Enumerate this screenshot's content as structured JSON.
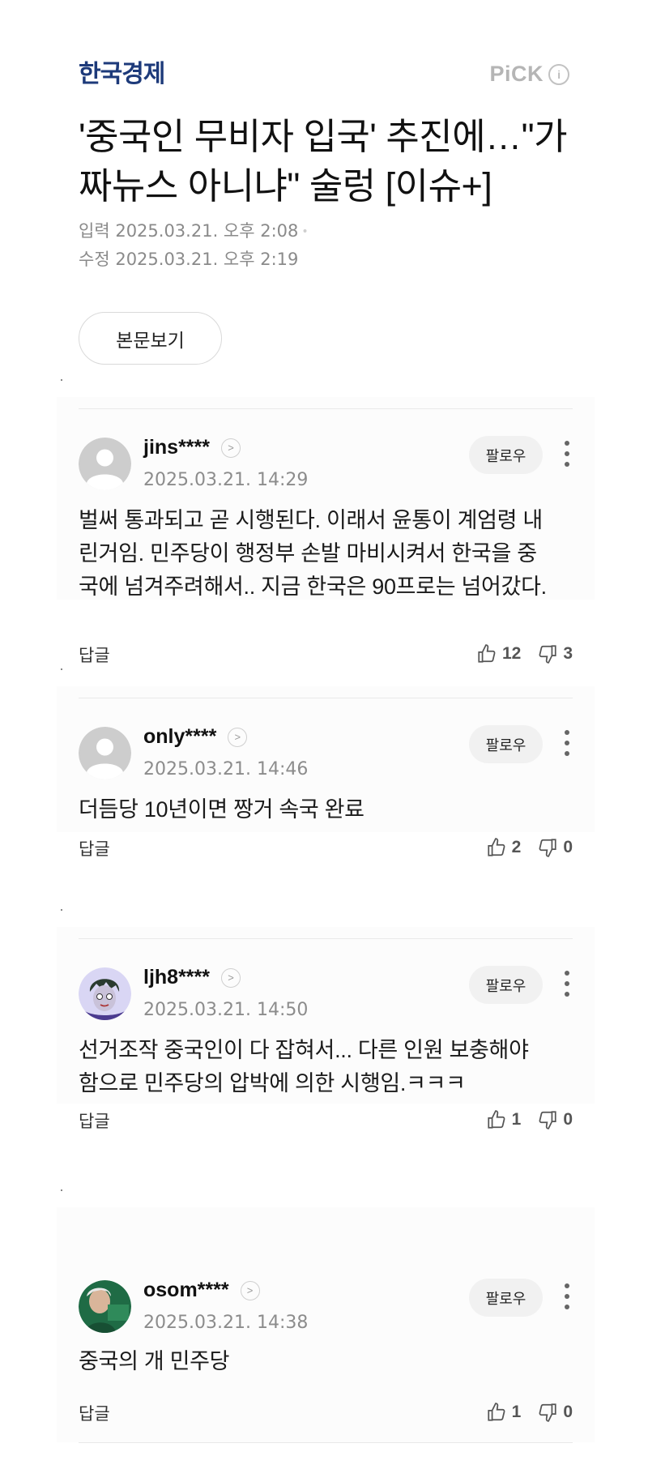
{
  "publisher": "한국경제",
  "pick": {
    "label": "PiCK",
    "info_icon": "i"
  },
  "headline": "'중국인 무비자 입국' 추진에…\"가짜뉴스 아니냐\" 술렁 [이슈+]",
  "meta": {
    "input_label": "입력",
    "input_time": "2025.03.21. 오후 2:08",
    "edit_label": "수정",
    "edit_time": "2025.03.21. 오후 2:19"
  },
  "view_body_label": "본문보기",
  "comment_ui": {
    "follow_label": "팔로우",
    "reply_label": "답글"
  },
  "comments": [
    {
      "user": "jins****",
      "time": "2025.03.21. 14:29",
      "text": "벌써 통과되고 곧 시행된다. 이래서 윤통이 계엄령 내린거임. 민주당이 행정부 손발 마비시켜서 한국을 중국에 넘겨주려해서.. 지금 한국은 90프로는 넘어갔다.",
      "likes": "12",
      "dislikes": "3",
      "avatar": "default"
    },
    {
      "user": "only****",
      "time": "2025.03.21. 14:46",
      "text": "더듬당 10년이면 짱거 속국 완료",
      "likes": "2",
      "dislikes": "0",
      "avatar": "default"
    },
    {
      "user": "ljh8****",
      "time": "2025.03.21. 14:50",
      "text": "선거조작 중국인이 다 잡혀서... 다른 인원 보충해야 함으로 민주당의 압박에 의한 시행임.ㅋㅋㅋ",
      "likes": "1",
      "dislikes": "0",
      "avatar": "cartoon"
    },
    {
      "user": "osom****",
      "time": "2025.03.21. 14:38",
      "text": "중국의 개 민주당",
      "likes": "1",
      "dislikes": "0",
      "avatar": "photo"
    }
  ],
  "colors": {
    "brand": "#1d3a7a",
    "muted": "#8c8c8c",
    "card_bg": "#fcfcfc"
  }
}
